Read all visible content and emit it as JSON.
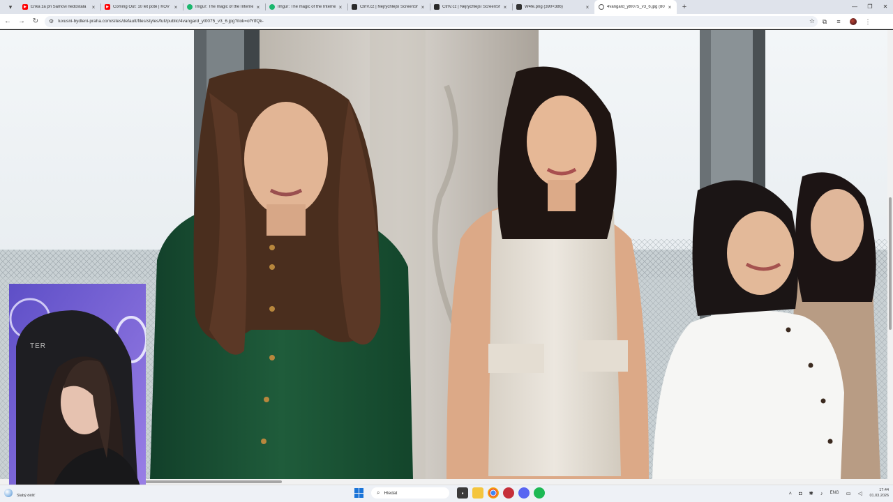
{
  "browser": {
    "tabs": [
      {
        "title": "Erika za při Samovi nedostala",
        "icon": "youtube-icon",
        "active": false
      },
      {
        "title": "Coming Out: 10 let poté | KOV",
        "icon": "youtube-icon",
        "active": false
      },
      {
        "title": "Imgur: The magic of the Interne",
        "icon": "imgur-icon",
        "active": false
      },
      {
        "title": "Imgur: The magic of the Interne",
        "icon": "imgur-icon",
        "active": false
      },
      {
        "title": "CtrlV.cz | Nejrychlejší ScreenSh",
        "icon": "ctrlv-icon",
        "active": false
      },
      {
        "title": "CtrlV.cz | Nejrychlejší ScreenSh",
        "icon": "ctrlv-icon",
        "active": false
      },
      {
        "title": "W4fe.png (390×386)",
        "icon": "w4fe-icon",
        "active": false
      },
      {
        "title": "4vangard_yt0075_v3_6.jpg (800",
        "icon": "globe-icon",
        "active": true
      }
    ],
    "url": "luxusni-bydleni-praha.com/sites/default/files/styles/full/public/4vangard_yt0075_v3_6.jpg?itok=ofYtfQk-"
  },
  "taskbar": {
    "weather_text": "Slabý déšť",
    "search_placeholder": "Hledat",
    "language": "ENG",
    "time": "17:44",
    "date": "01.03.2026"
  }
}
